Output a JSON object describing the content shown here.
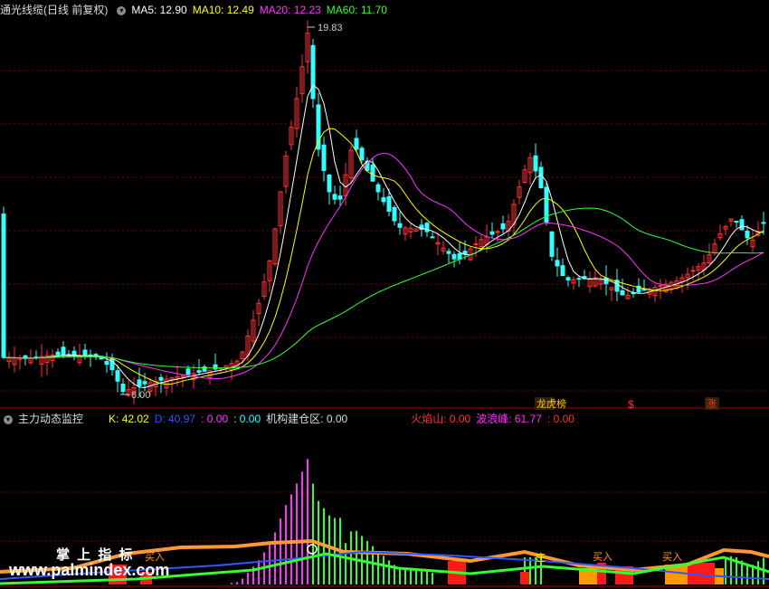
{
  "main_panel": {
    "title": "通光线缆(日线 前复权)",
    "ma": [
      {
        "label": "MA5: 12.90",
        "color": "#ffffff"
      },
      {
        "label": "MA10: 12.49",
        "color": "#ffff00"
      },
      {
        "label": "MA20: 12.23",
        "color": "#ff33ff"
      },
      {
        "label": "MA60: 11.70",
        "color": "#33ff33"
      }
    ],
    "high_label": "19.83",
    "low_label": "6.00",
    "markers": [
      {
        "text": "龙虎榜",
        "color": "#ff3333"
      },
      {
        "text": "$",
        "color": "#ff3333"
      },
      {
        "text": "涨",
        "color": "#ff3333"
      }
    ]
  },
  "sub_panel": {
    "title": "主力动态监控",
    "k": "K: 42.02",
    "d": "D: 40.97",
    "v1": ": 0.00",
    "v2": ": 0.00",
    "jigou": "机构建仓区: 0.00",
    "huoyan": "火焰山: 0.00",
    "bolang": "波浪峰: 61.77",
    "v3": ": 0.00",
    "signals": [
      "买入",
      "买入",
      "买入"
    ],
    "zhuang": "庄"
  },
  "watermark": {
    "line1": "掌 上 指 标",
    "line2": "www.palmindex.com"
  },
  "colors": {
    "bull": "#ff3333",
    "bear": "#33ffff",
    "ma5": "#ffffff",
    "ma10": "#ffff00",
    "ma20": "#ff33ff",
    "ma60": "#33ff33",
    "grid": "#8b0000"
  }
}
